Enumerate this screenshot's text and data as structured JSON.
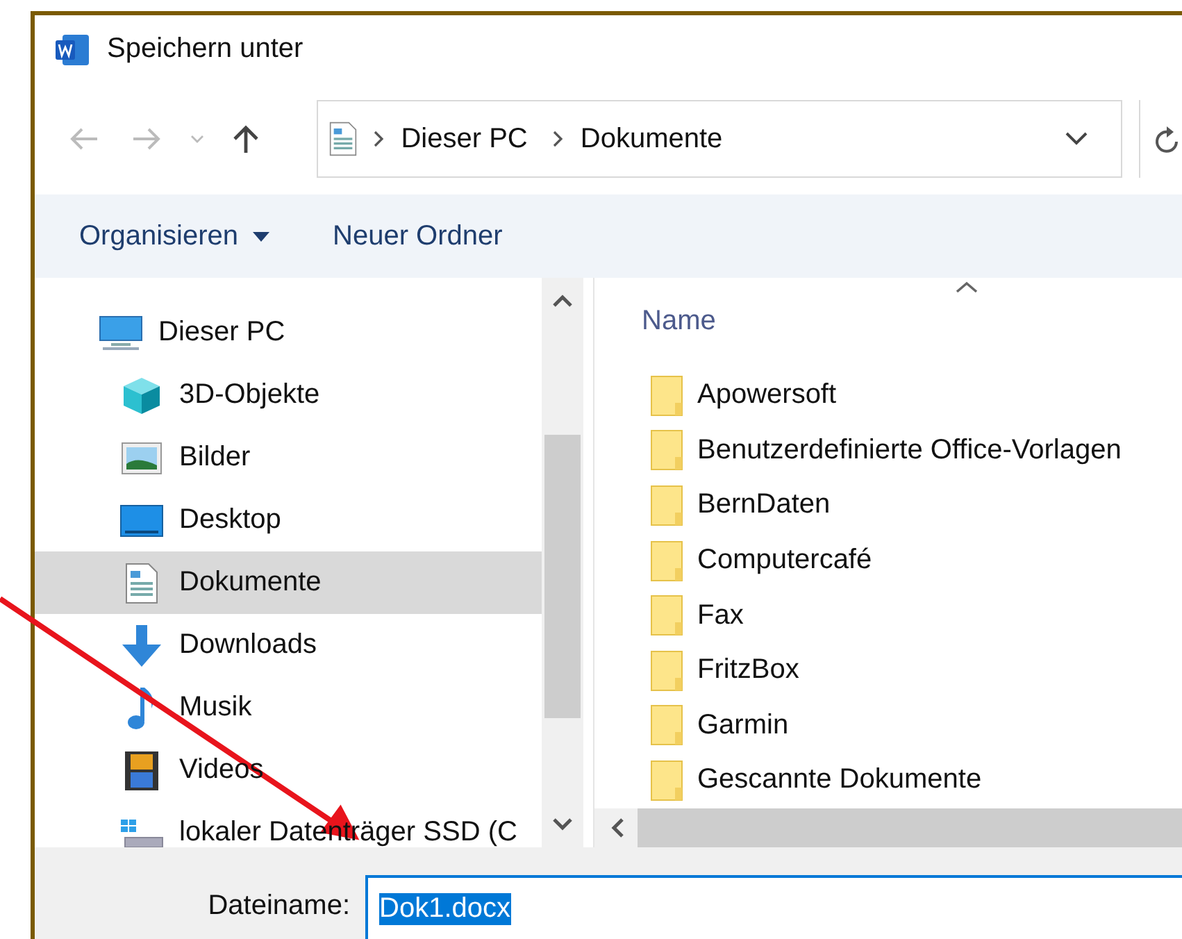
{
  "window": {
    "title": "Speichern unter"
  },
  "address": {
    "breadcrumbs": [
      "Dieser PC",
      "Dokumente"
    ]
  },
  "toolbar": {
    "buttons": [
      {
        "label": "Organisieren",
        "kind": "menu"
      },
      {
        "label": "Neuer Ordner",
        "kind": "plain"
      }
    ]
  },
  "navigation": {
    "items": [
      {
        "label": "Dieser PC",
        "kind": "pc",
        "selected": false,
        "children": [
          {
            "label": "3D-Objekte",
            "kind": "objects3d",
            "selected": false
          },
          {
            "label": "Bilder",
            "kind": "pictures",
            "selected": false
          },
          {
            "label": "Desktop",
            "kind": "desktop",
            "selected": false
          },
          {
            "label": "Dokumente",
            "kind": "documents",
            "selected": true
          },
          {
            "label": "Downloads",
            "kind": "downloads",
            "selected": false
          },
          {
            "label": "Musik",
            "kind": "music",
            "selected": false
          },
          {
            "label": "Videos",
            "kind": "videos",
            "selected": false
          },
          {
            "label": "lokaler Datenträger SSD (C",
            "kind": "drive",
            "selected": false
          }
        ]
      }
    ]
  },
  "file_list": {
    "column": "Name",
    "items": [
      {
        "name": "Apowersoft"
      },
      {
        "name": "Benutzerdefinierte Office-Vorlagen"
      },
      {
        "name": "BernDaten"
      },
      {
        "name": "Computercafé"
      },
      {
        "name": "Fax"
      },
      {
        "name": "FritzBox"
      },
      {
        "name": "Garmin"
      },
      {
        "name": "Gescannte Dokumente"
      }
    ]
  },
  "filename": {
    "label": "Dateiname:",
    "value": "Dok1.docx",
    "text_selected": true
  }
}
